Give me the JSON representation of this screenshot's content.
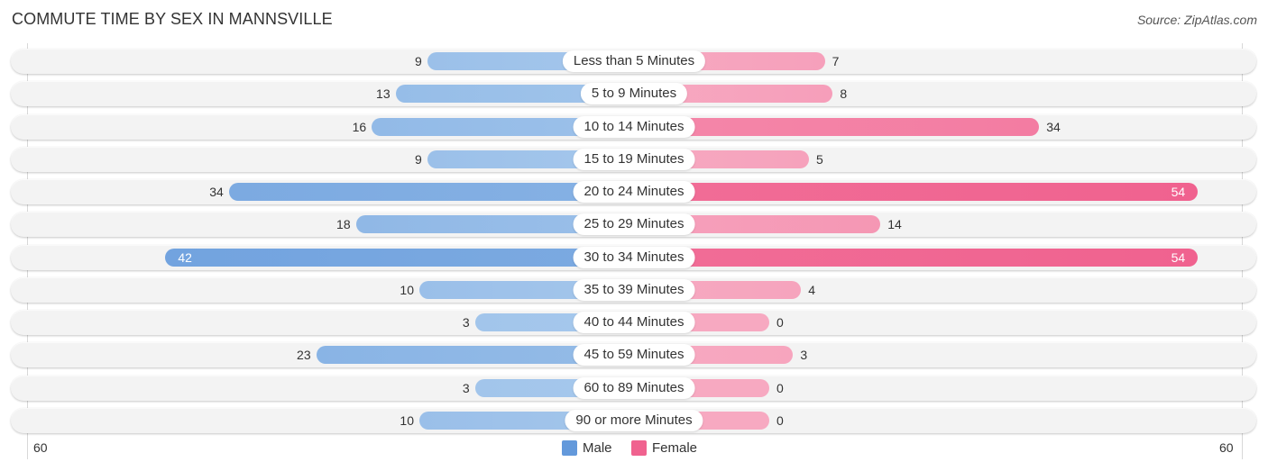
{
  "chart_data": {
    "type": "bar",
    "orientation": "horizontal-diverging",
    "title": "COMMUTE TIME BY SEX IN MANNSVILLE",
    "source": "Source: ZipAtlas.com",
    "categories": [
      "Less than 5 Minutes",
      "5 to 9 Minutes",
      "10 to 14 Minutes",
      "15 to 19 Minutes",
      "20 to 24 Minutes",
      "25 to 29 Minutes",
      "30 to 34 Minutes",
      "35 to 39 Minutes",
      "40 to 44 Minutes",
      "45 to 59 Minutes",
      "60 to 89 Minutes",
      "90 or more Minutes"
    ],
    "series": [
      {
        "name": "Male",
        "side": "left",
        "color_light": "#a6c8ec",
        "color_dark": "#6399db",
        "values": [
          9,
          13,
          16,
          9,
          34,
          18,
          42,
          10,
          3,
          23,
          3,
          10
        ]
      },
      {
        "name": "Female",
        "side": "right",
        "color_light": "#f7a9c1",
        "color_dark": "#f0628f",
        "values": [
          7,
          8,
          34,
          5,
          54,
          14,
          54,
          4,
          0,
          3,
          0,
          0
        ]
      }
    ],
    "axis": {
      "left_label": "60",
      "right_label": "60",
      "max": 60
    },
    "legend": {
      "position": "bottom-center",
      "items": [
        "Male",
        "Female"
      ]
    },
    "grid": false
  }
}
